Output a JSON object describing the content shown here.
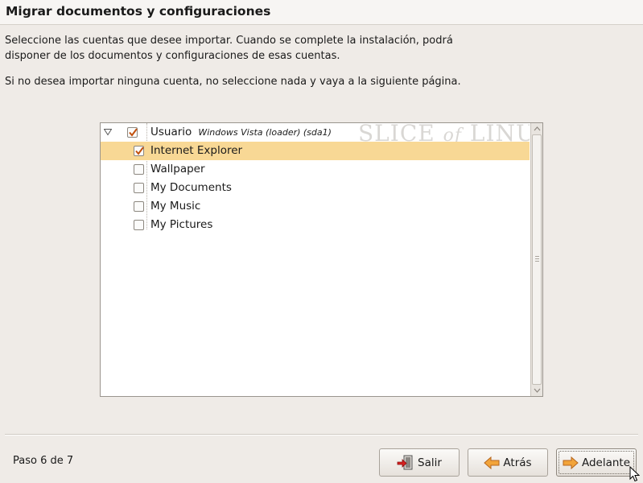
{
  "header": {
    "title": "Migrar documentos y configuraciones"
  },
  "intro": {
    "line1": "Seleccione las cuentas que desee importar. Cuando se complete la instalación, podrá",
    "line2": "disponer de los documentos y configuraciones de esas cuentas.",
    "hint": "Si no desea importar ninguna cuenta, no seleccione nada y vaya a la siguiente página."
  },
  "tree": {
    "account": {
      "label": "Usuario",
      "detail": "Windows Vista (loader) (sda1)",
      "checked": true,
      "expanded": true
    },
    "items": [
      {
        "label": "Internet Explorer",
        "checked": true,
        "selected": true
      },
      {
        "label": "Wallpaper",
        "checked": false,
        "selected": false
      },
      {
        "label": "My Documents",
        "checked": false,
        "selected": false
      },
      {
        "label": "My Music",
        "checked": false,
        "selected": false
      },
      {
        "label": "My Pictures",
        "checked": false,
        "selected": false
      }
    ]
  },
  "watermark": {
    "part1": "SLICE",
    "part2": "of",
    "part3": "LINUX"
  },
  "footer": {
    "step": "Paso 6 de 7",
    "quit_label": "Salir",
    "back_label": "Atrás",
    "forward_label": "Adelante"
  },
  "colors": {
    "selection": "#f8d895",
    "checkmark": "#c2500e",
    "background": "#efebe7"
  },
  "icons": {
    "quit": "quit-door-icon",
    "back": "arrow-left-icon",
    "forward": "arrow-right-icon",
    "expander": "triangle-down-icon",
    "checkbox": "checkmark-icon"
  }
}
